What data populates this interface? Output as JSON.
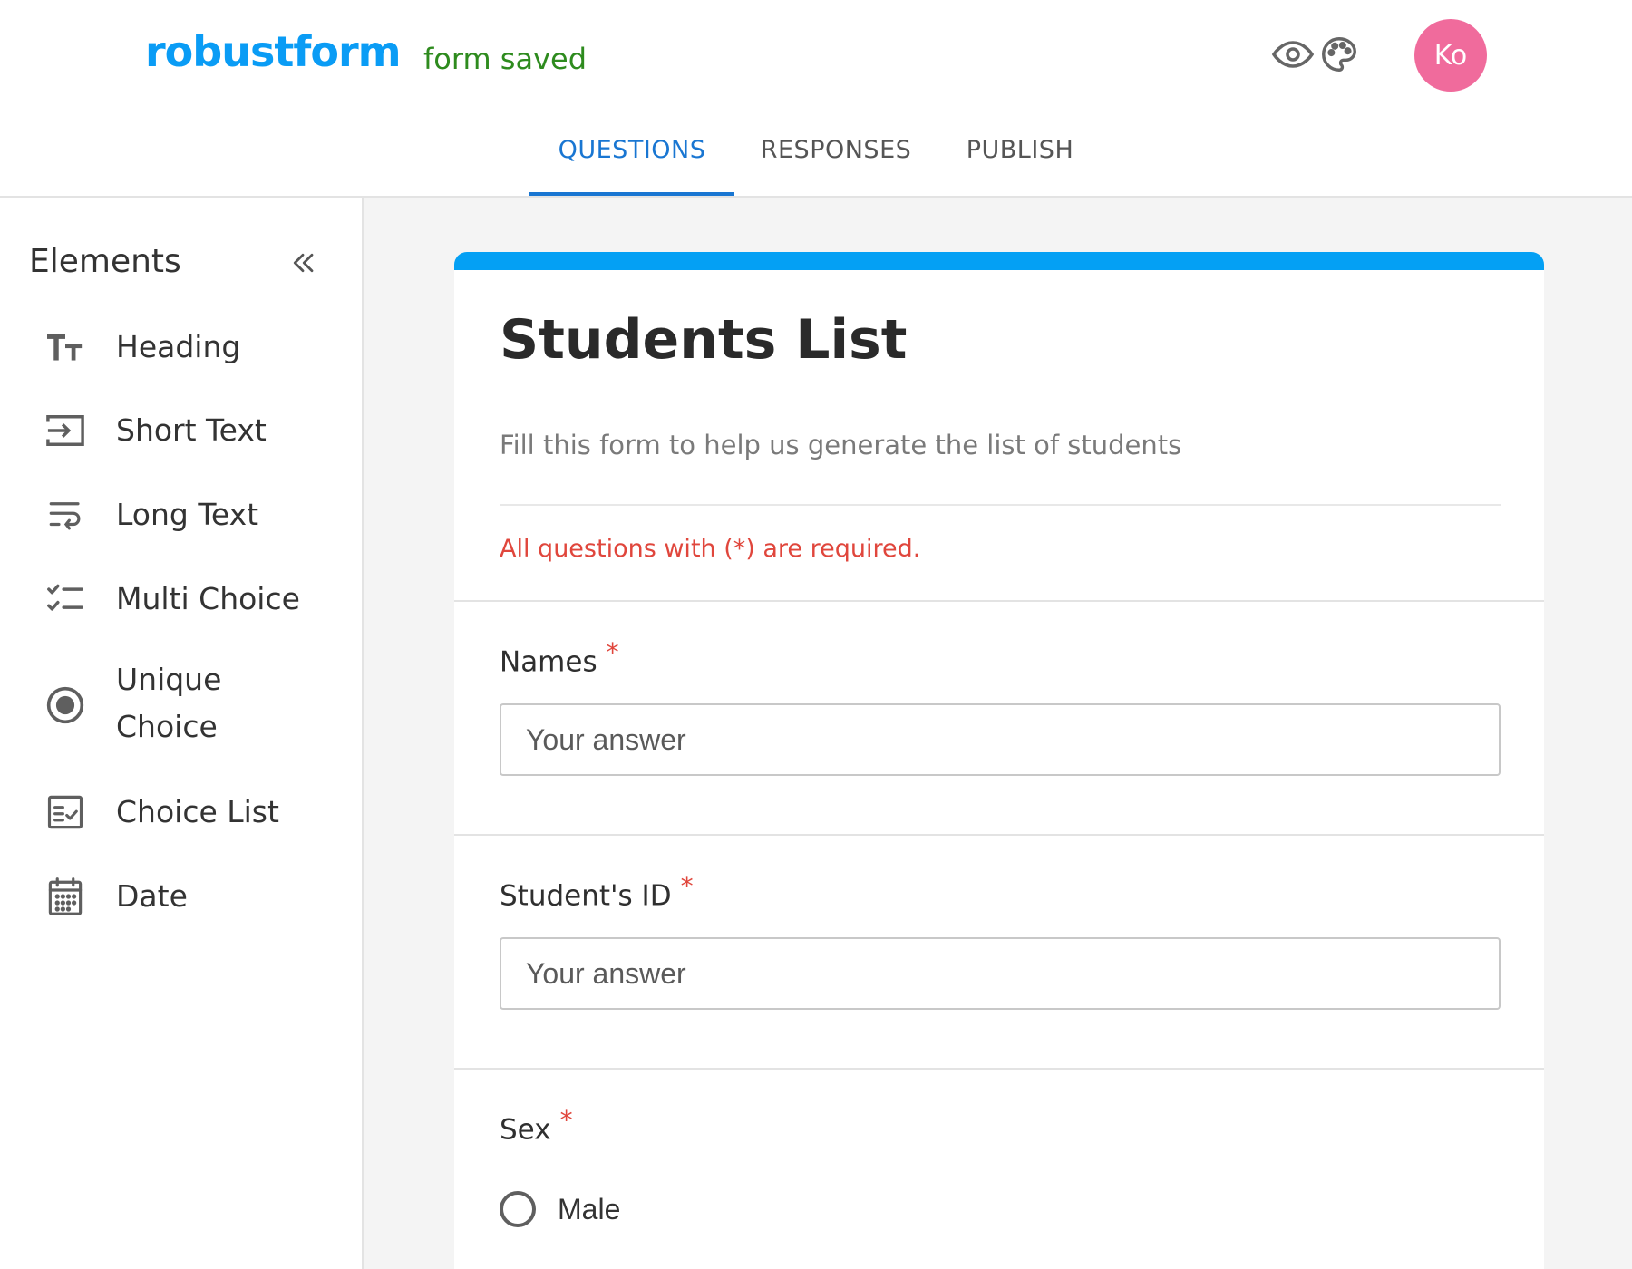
{
  "header": {
    "logo": "robustform",
    "save_status": "form saved",
    "icons": [
      "palette-icon",
      "eye-icon"
    ],
    "avatar_initials": "Ko",
    "avatar_color": "#f06b9c"
  },
  "tabs": [
    {
      "label": "QUESTIONS",
      "active": true
    },
    {
      "label": "RESPONSES",
      "active": false
    },
    {
      "label": "PUBLISH",
      "active": false
    }
  ],
  "sidebar": {
    "title": "Elements",
    "collapse_icon": "double-chevron-left-icon",
    "items": [
      {
        "label": "Heading",
        "icon": "text-size-icon"
      },
      {
        "label": "Short Text",
        "icon": "input-arrow-icon"
      },
      {
        "label": "Long Text",
        "icon": "text-wrap-icon"
      },
      {
        "label": "Multi Choice",
        "icon": "checklist-icon"
      },
      {
        "label": "Unique Choice",
        "icon": "radio-button-icon"
      },
      {
        "label": "Choice List",
        "icon": "list-check-icon"
      },
      {
        "label": "Date",
        "icon": "calendar-icon"
      }
    ]
  },
  "form": {
    "accent_color": "#04a0f4",
    "title": "Students List",
    "description": "Fill this form to help us generate the list of students",
    "required_note": "All questions with (*) are required.",
    "questions": [
      {
        "label": "Names",
        "required_mark": "*",
        "placeholder": "Your answer"
      },
      {
        "label": "Student's ID",
        "required_mark": "*",
        "placeholder": "Your answer"
      },
      {
        "label": "Sex",
        "required_mark": "*",
        "options": [
          "Male"
        ]
      }
    ]
  },
  "colors": {
    "brand": "#0a9cf5",
    "active_tab": "#1976d2",
    "saved": "#2e8b1e",
    "required": "#e0463c"
  }
}
